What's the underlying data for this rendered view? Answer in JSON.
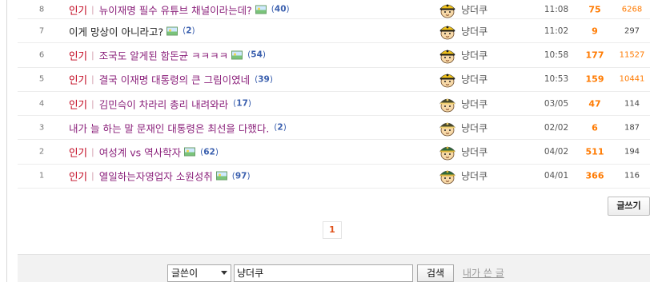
{
  "posts": [
    {
      "num": "8",
      "hot": "인기",
      "bar": "|",
      "title": "뉴이재명 필수 유튜브 채널이라는데?",
      "has_image": true,
      "comments": "40",
      "writer": "냥더쿠",
      "avatar": "yellow-cap",
      "date": "11:08",
      "recommend": "75",
      "views": "6268",
      "views_hi": true
    },
    {
      "num": "7",
      "hot": "",
      "bar": "",
      "title": "이게 망상이 아니라고?",
      "has_image": true,
      "comments": "2",
      "writer": "냥더쿠",
      "avatar": "yellow-cap",
      "date": "11:02",
      "recommend": "9",
      "views": "297",
      "views_hi": false
    },
    {
      "num": "6",
      "hot": "인기",
      "bar": "|",
      "title": "조국도 알게된 함돈균 ㅋㅋㅋㅋ",
      "has_image": true,
      "comments": "54",
      "writer": "냥더쿠",
      "avatar": "yellow-cap",
      "date": "10:58",
      "recommend": "177",
      "views": "11527",
      "views_hi": true
    },
    {
      "num": "5",
      "hot": "인기",
      "bar": "|",
      "title": "결국 이재명 대통령의 큰 그림이였네",
      "has_image": false,
      "comments": "39",
      "writer": "냥더쿠",
      "avatar": "yellow-cap",
      "date": "10:53",
      "recommend": "159",
      "views": "10441",
      "views_hi": true
    },
    {
      "num": "4",
      "hot": "인기",
      "bar": "|",
      "title": "김민슥이 차라리 총리 내려와라",
      "has_image": false,
      "comments": "17",
      "writer": "냥더쿠",
      "avatar": "olive-cap",
      "date": "03/05",
      "recommend": "47",
      "views": "114",
      "views_hi": false
    },
    {
      "num": "3",
      "hot": "",
      "bar": "",
      "title": "내가 늘 하는 말 문재인 대통령은 최선을 다했다.",
      "has_image": false,
      "comments": "2",
      "writer": "냥더쿠",
      "avatar": "olive-cap",
      "date": "02/02",
      "recommend": "6",
      "views": "187",
      "views_hi": false
    },
    {
      "num": "2",
      "hot": "인기",
      "bar": "|",
      "title": "여성계 vs 역사학자",
      "has_image": true,
      "comments": "62",
      "writer": "냥더쿠",
      "avatar": "green-cap",
      "date": "04/02",
      "recommend": "511",
      "views": "194",
      "views_hi": false
    },
    {
      "num": "1",
      "hot": "인기",
      "bar": "|",
      "title": "열일하는자영업자 소원성취",
      "has_image": true,
      "comments": "97",
      "writer": "냥더쿠",
      "avatar": "green-cap",
      "date": "04/01",
      "recommend": "366",
      "views": "116",
      "views_hi": false
    }
  ],
  "write_button": "글쓰기",
  "pagination": {
    "current": "1"
  },
  "search": {
    "field_selected": "글쓴이",
    "query": "냥더쿠",
    "search_button": "검색",
    "my_posts_link": "내가 쓴 글"
  },
  "colors": {
    "hot_label": "#c0001a",
    "subject": "#8a1f7a",
    "recommend": "#ff7a00",
    "comment_count": "#3a5fae",
    "page_current": "#e0521b"
  }
}
